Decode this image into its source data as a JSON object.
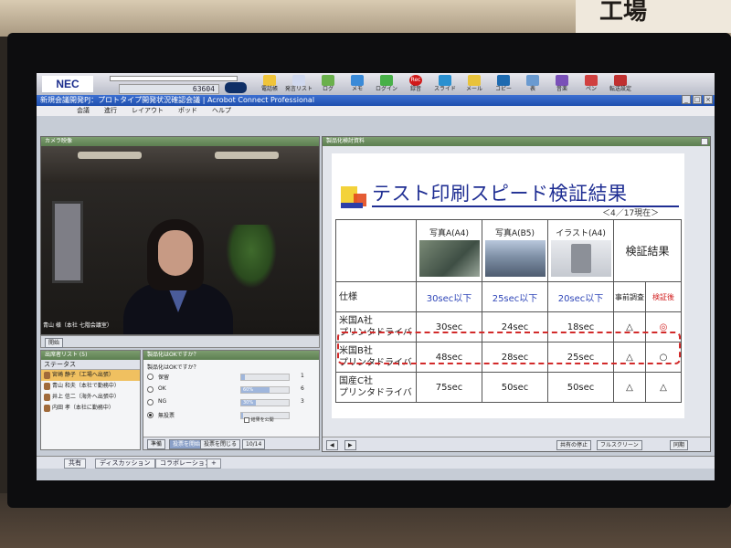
{
  "environment": {
    "wall_sign_text": "工場"
  },
  "app": {
    "brand": "NEC",
    "counter_value": "63604",
    "window_title": "新規会議開発PJ：プロトタイプ開発状況確認会議 | Acrobot Connect Professional",
    "toolbar": [
      {
        "label": "電話帳",
        "icon": "phonebook-icon",
        "color": "#f0c43a"
      },
      {
        "label": "発言リスト",
        "icon": "speaker-list-icon",
        "color": "#d0d8ee"
      },
      {
        "label": "ログ",
        "icon": "log-icon",
        "color": "#6ab04c"
      },
      {
        "label": "メモ",
        "icon": "memo-icon",
        "color": "#3a8ad8"
      },
      {
        "label": "ログイン",
        "icon": "login-icon",
        "color": "#48b048"
      },
      {
        "label": "録音",
        "icon": "record-icon",
        "color": "#d01818"
      },
      {
        "label": "スライド",
        "icon": "slide-icon",
        "color": "#2a90d0"
      },
      {
        "label": "メール",
        "icon": "mail-icon",
        "color": "#e8c23a"
      },
      {
        "label": "コピー",
        "icon": "copy-icon",
        "color": "#1d6ab0"
      },
      {
        "label": "表",
        "icon": "table-icon",
        "color": "#6a9ad0"
      },
      {
        "label": "音楽",
        "icon": "music-icon",
        "color": "#7a50b8"
      },
      {
        "label": "ペン",
        "icon": "pen-icon",
        "color": "#d04040"
      },
      {
        "label": "転送設定",
        "icon": "forward-icon",
        "color": "#c03030"
      }
    ],
    "record_label": "Rec",
    "window_buttons": [
      "_",
      "□",
      "×"
    ],
    "menu": [
      "会議",
      "進行",
      "レイアウト",
      "ポッド",
      "ヘルプ"
    ]
  },
  "video_pod": {
    "title": "カメラ映像",
    "caption": "青山 様（本社 七階会議室）",
    "footer_button": "開始"
  },
  "attendees_pod": {
    "title": "出席者リスト (5)",
    "status_label": "ステータス",
    "attendees": [
      {
        "name": "宮崎 静子（工場へ出張）",
        "selected": true
      },
      {
        "name": "青山 和夫（本社で勤務中）",
        "selected": false
      },
      {
        "name": "井上 信二（海外へ出張中）",
        "selected": false
      },
      {
        "name": "内田 孝（本社に勤務中）",
        "selected": false
      }
    ]
  },
  "poll_pod": {
    "title": "製品化はOKですか？",
    "question": "製品化はOKですか？",
    "options": [
      {
        "label": "保留",
        "percent": 8,
        "count": "1",
        "checked": false
      },
      {
        "label": "OK",
        "percent": 60,
        "count": "6",
        "checked": false
      },
      {
        "label": "NG",
        "percent": 30,
        "count": "3",
        "checked": false
      },
      {
        "label": "無投票",
        "percent": 0,
        "count": "",
        "checked": true
      }
    ],
    "pct_labels": [
      "",
      "60%",
      "30%",
      ""
    ],
    "publish_label": "結果を公開",
    "buttons": [
      "準備",
      "投票を開始",
      "投票を閉じる",
      "10/14"
    ]
  },
  "slide_pod": {
    "title": "製品化検討資料",
    "slide_title": "テスト印刷スピード検証結果",
    "as_of": "＜4／17現在＞",
    "columns": [
      "写真A(A4)",
      "写真A(B5)",
      "イラスト(A4)"
    ],
    "result_header": "検証結果",
    "spec_label": "仕様",
    "spec_values": [
      "30sec以下",
      "25sec以下",
      "20sec以下"
    ],
    "pre_check": "事前調査",
    "post_check": "検証後",
    "rows": [
      {
        "name_line1": "米国A社",
        "name_line2": "プリンタドライバ",
        "values": [
          "30sec",
          "24sec",
          "18sec"
        ],
        "pre": "△",
        "post": "◎"
      },
      {
        "name_line1": "米国B社",
        "name_line2": "プリンタドライバ",
        "values": [
          "48sec",
          "28sec",
          "25sec"
        ],
        "pre": "△",
        "post": "○"
      },
      {
        "name_line1": "国産C社",
        "name_line2": "プリンタドライバ",
        "values": [
          "75sec",
          "50sec",
          "50sec"
        ],
        "pre": "△",
        "post": "△"
      }
    ],
    "footer": {
      "page": "",
      "view_label": "共有の停止",
      "fullscreen_label": "フルスクリーン",
      "sync_label": "同期"
    }
  },
  "bottombar": {
    "tabs": [
      "共有",
      "ディスカッション",
      "コラボレーション"
    ],
    "add_label": "+"
  }
}
